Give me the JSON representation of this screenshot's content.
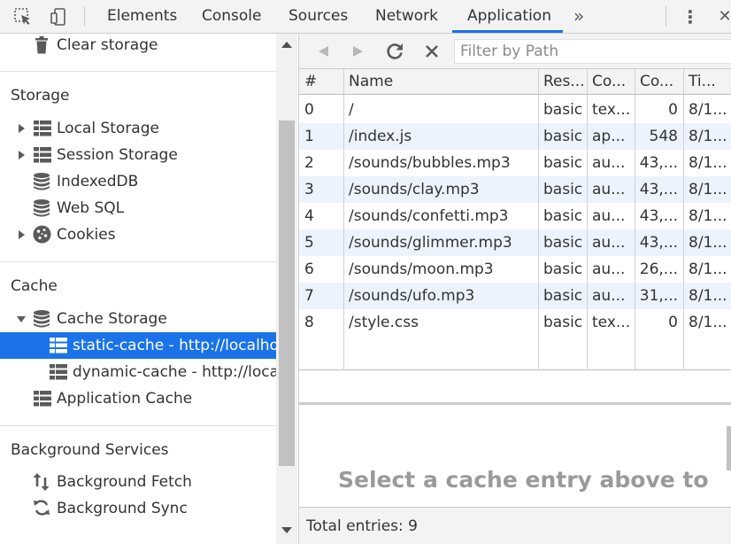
{
  "toolbar": {
    "tabs": [
      {
        "label": "Elements"
      },
      {
        "label": "Console"
      },
      {
        "label": "Sources"
      },
      {
        "label": "Network"
      },
      {
        "label": "Application"
      }
    ],
    "more_tabs": "»",
    "menu": "⋮",
    "close": "✕",
    "active_tab": "Application"
  },
  "sidebar": {
    "clear_storage": "Clear storage",
    "storage_header": "Storage",
    "storage_items": [
      {
        "label": "Local Storage",
        "icon": "grid-icon",
        "expandable": true
      },
      {
        "label": "Session Storage",
        "icon": "grid-icon",
        "expandable": true
      },
      {
        "label": "IndexedDB",
        "icon": "database-icon",
        "expandable": false
      },
      {
        "label": "Web SQL",
        "icon": "database-icon",
        "expandable": false
      },
      {
        "label": "Cookies",
        "icon": "cookie-icon",
        "expandable": true
      }
    ],
    "cache_header": "Cache",
    "cache_storage": "Cache Storage",
    "caches": [
      {
        "label": "static-cache - http://localhost",
        "selected": true
      },
      {
        "label": "dynamic-cache - http://localhost",
        "selected": false
      }
    ],
    "app_cache": "Application Cache",
    "bg_header": "Background Services",
    "bg_fetch": "Background Fetch",
    "bg_sync": "Background Sync"
  },
  "cache_view": {
    "filter_placeholder": "Filter by Path",
    "columns": [
      "#",
      "Name",
      "Res...",
      "Co...",
      "Co...",
      "Ti..."
    ],
    "rows": [
      {
        "idx": "0",
        "name": "/",
        "res": "basic",
        "ctype": "tex...",
        "clen": "0",
        "time": "8/1..."
      },
      {
        "idx": "1",
        "name": "/index.js",
        "res": "basic",
        "ctype": "ap...",
        "clen": "548",
        "time": "8/1..."
      },
      {
        "idx": "2",
        "name": "/sounds/bubbles.mp3",
        "res": "basic",
        "ctype": "au...",
        "clen": "43,...",
        "time": "8/1..."
      },
      {
        "idx": "3",
        "name": "/sounds/clay.mp3",
        "res": "basic",
        "ctype": "au...",
        "clen": "43,...",
        "time": "8/1..."
      },
      {
        "idx": "4",
        "name": "/sounds/confetti.mp3",
        "res": "basic",
        "ctype": "au...",
        "clen": "43,...",
        "time": "8/1..."
      },
      {
        "idx": "5",
        "name": "/sounds/glimmer.mp3",
        "res": "basic",
        "ctype": "au...",
        "clen": "43,...",
        "time": "8/1..."
      },
      {
        "idx": "6",
        "name": "/sounds/moon.mp3",
        "res": "basic",
        "ctype": "au...",
        "clen": "26,...",
        "time": "8/1..."
      },
      {
        "idx": "7",
        "name": "/sounds/ufo.mp3",
        "res": "basic",
        "ctype": "au...",
        "clen": "31,...",
        "time": "8/1..."
      },
      {
        "idx": "8",
        "name": "/style.css",
        "res": "basic",
        "ctype": "tex...",
        "clen": "0",
        "time": "8/1..."
      }
    ],
    "preview_message": "Select a cache entry above to",
    "total": "Total entries: 9"
  },
  "colors": {
    "accent": "#1a73e8",
    "row_alt": "#edf3fd",
    "toolbar_bg": "#f3f3f3"
  }
}
